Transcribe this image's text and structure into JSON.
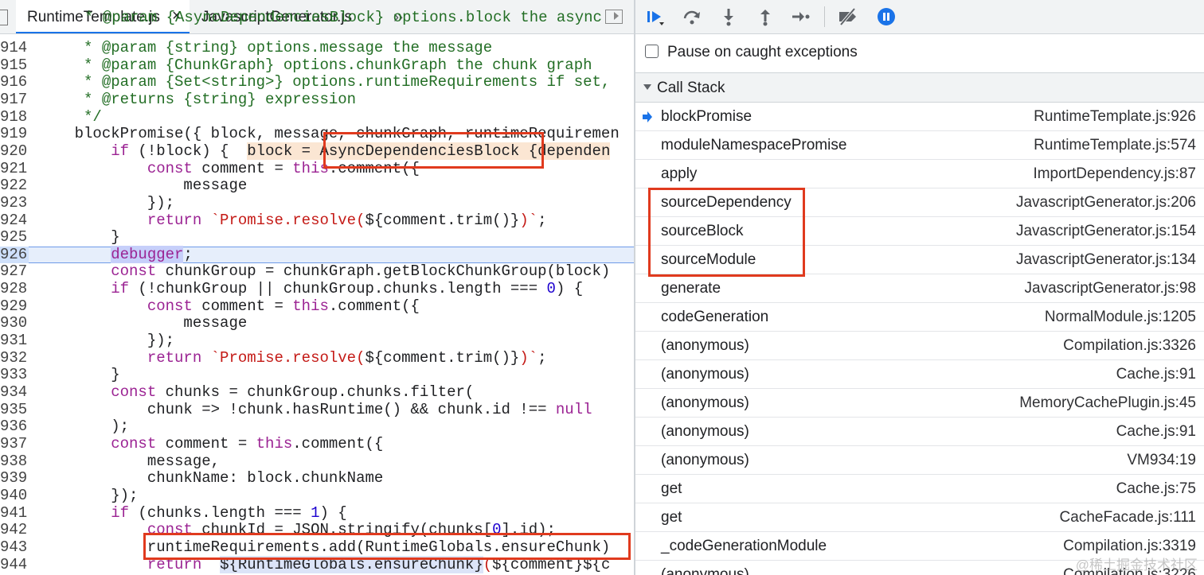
{
  "editor": {
    "tabs": [
      {
        "label": "RuntimeTemplate.js",
        "active": true,
        "close_glyph": "×"
      },
      {
        "label": "JavascriptGenerator.js",
        "active": false
      }
    ],
    "more_tabs_glyph": "»",
    "partial_top_line": "* @param {AsyncDependenciesBlock} options.block the async",
    "lines": [
      {
        "num": "914",
        "segments": [
          {
            "t": "     * @param {string} options.message the message",
            "c": "com"
          }
        ]
      },
      {
        "num": "915",
        "segments": [
          {
            "t": "     * @param {ChunkGraph} options.chunkGraph the chunk graph",
            "c": "com"
          }
        ]
      },
      {
        "num": "916",
        "segments": [
          {
            "t": "     * @param {Set<string>} options.runtimeRequirements if set, ",
            "c": "com"
          }
        ]
      },
      {
        "num": "917",
        "segments": [
          {
            "t": "     * @returns {string} expression",
            "c": "com"
          }
        ]
      },
      {
        "num": "918",
        "segments": [
          {
            "t": "     */",
            "c": "com"
          }
        ]
      },
      {
        "num": "919",
        "segments": [
          {
            "t": "    blockPromise({ block, message, chunkGraph, runtimeRequiremen",
            "c": ""
          }
        ]
      },
      {
        "num": "920",
        "segments": [
          {
            "t": "        ",
            "c": ""
          },
          {
            "t": "if",
            "c": "kw"
          },
          {
            "t": " (!block) {  ",
            "c": ""
          },
          {
            "t": "block = AsyncDependenciesBlock {dependen",
            "c": "inline"
          }
        ]
      },
      {
        "num": "921",
        "segments": [
          {
            "t": "            ",
            "c": ""
          },
          {
            "t": "const",
            "c": "kw"
          },
          {
            "t": " comment = ",
            "c": ""
          },
          {
            "t": "this",
            "c": "kw"
          },
          {
            "t": ".comment({",
            "c": ""
          }
        ]
      },
      {
        "num": "922",
        "segments": [
          {
            "t": "                message",
            "c": ""
          }
        ]
      },
      {
        "num": "923",
        "segments": [
          {
            "t": "            });",
            "c": ""
          }
        ]
      },
      {
        "num": "924",
        "segments": [
          {
            "t": "            ",
            "c": ""
          },
          {
            "t": "return",
            "c": "kw"
          },
          {
            "t": " `Promise.resolve(",
            "c": "str"
          },
          {
            "t": "${comment.trim()}",
            "c": ""
          },
          {
            "t": ")`",
            "c": "str"
          },
          {
            "t": ";",
            "c": ""
          }
        ]
      },
      {
        "num": "925",
        "segments": [
          {
            "t": "        }",
            "c": ""
          }
        ]
      },
      {
        "num": "926",
        "segments": [
          {
            "t": "        ",
            "c": ""
          },
          {
            "t": "debugger",
            "c": "debugger"
          },
          {
            "t": ";",
            "c": ""
          }
        ],
        "current": true
      },
      {
        "num": "927",
        "segments": [
          {
            "t": "        ",
            "c": ""
          },
          {
            "t": "const",
            "c": "kw"
          },
          {
            "t": " chunkGroup = chunkGraph.getBlockChunkGroup(block)",
            "c": ""
          }
        ]
      },
      {
        "num": "928",
        "segments": [
          {
            "t": "        ",
            "c": ""
          },
          {
            "t": "if",
            "c": "kw"
          },
          {
            "t": " (!chunkGroup || chunkGroup.chunks.length === ",
            "c": ""
          },
          {
            "t": "0",
            "c": "num"
          },
          {
            "t": ") {",
            "c": ""
          }
        ]
      },
      {
        "num": "929",
        "segments": [
          {
            "t": "            ",
            "c": ""
          },
          {
            "t": "const",
            "c": "kw"
          },
          {
            "t": " comment = ",
            "c": ""
          },
          {
            "t": "this",
            "c": "kw"
          },
          {
            "t": ".comment({",
            "c": ""
          }
        ]
      },
      {
        "num": "930",
        "segments": [
          {
            "t": "                message",
            "c": ""
          }
        ]
      },
      {
        "num": "931",
        "segments": [
          {
            "t": "            });",
            "c": ""
          }
        ]
      },
      {
        "num": "932",
        "segments": [
          {
            "t": "            ",
            "c": ""
          },
          {
            "t": "return",
            "c": "kw"
          },
          {
            "t": " `Promise.resolve(",
            "c": "str"
          },
          {
            "t": "${comment.trim()}",
            "c": ""
          },
          {
            "t": ")`",
            "c": "str"
          },
          {
            "t": ";",
            "c": ""
          }
        ]
      },
      {
        "num": "933",
        "segments": [
          {
            "t": "        }",
            "c": ""
          }
        ]
      },
      {
        "num": "934",
        "segments": [
          {
            "t": "        ",
            "c": ""
          },
          {
            "t": "const",
            "c": "kw"
          },
          {
            "t": " chunks = chunkGroup.chunks.filter(",
            "c": ""
          }
        ]
      },
      {
        "num": "935",
        "segments": [
          {
            "t": "            chunk => !chunk.hasRuntime() && chunk.id !== ",
            "c": ""
          },
          {
            "t": "null",
            "c": "kw"
          }
        ]
      },
      {
        "num": "936",
        "segments": [
          {
            "t": "        );",
            "c": ""
          }
        ]
      },
      {
        "num": "937",
        "segments": [
          {
            "t": "        ",
            "c": ""
          },
          {
            "t": "const",
            "c": "kw"
          },
          {
            "t": " comment = ",
            "c": ""
          },
          {
            "t": "this",
            "c": "kw"
          },
          {
            "t": ".comment({",
            "c": ""
          }
        ]
      },
      {
        "num": "938",
        "segments": [
          {
            "t": "            message,",
            "c": ""
          }
        ]
      },
      {
        "num": "939",
        "segments": [
          {
            "t": "            chunkName: block.chunkName",
            "c": ""
          }
        ]
      },
      {
        "num": "940",
        "segments": [
          {
            "t": "        });",
            "c": ""
          }
        ]
      },
      {
        "num": "941",
        "segments": [
          {
            "t": "        ",
            "c": ""
          },
          {
            "t": "if",
            "c": "kw"
          },
          {
            "t": " (chunks.length === ",
            "c": ""
          },
          {
            "t": "1",
            "c": "num"
          },
          {
            "t": ") {",
            "c": ""
          }
        ]
      },
      {
        "num": "942",
        "segments": [
          {
            "t": "            ",
            "c": ""
          },
          {
            "t": "const",
            "c": "kw"
          },
          {
            "t": " chunkId = JSON.stringify(chunks[",
            "c": ""
          },
          {
            "t": "0",
            "c": "num"
          },
          {
            "t": "].id);",
            "c": ""
          }
        ]
      },
      {
        "num": "943",
        "segments": [
          {
            "t": "            runtimeRequirements.add(RuntimeGlobals.ensureChunk)",
            "c": ""
          }
        ]
      },
      {
        "num": "944",
        "segments": [
          {
            "t": "            ",
            "c": ""
          },
          {
            "t": "return",
            "c": "kw"
          },
          {
            "t": " `",
            "c": "str"
          },
          {
            "t": "${RuntimeGlobals.ensureChunk}",
            "c": "blue"
          },
          {
            "t": "(",
            "c": "str"
          },
          {
            "t": "${comment}${c",
            "c": ""
          }
        ]
      }
    ]
  },
  "debugger": {
    "toolbar": [
      {
        "name": "resume-icon",
        "title": "Resume script execution"
      },
      {
        "name": "step-over-icon",
        "title": "Step over next function call"
      },
      {
        "name": "step-into-icon",
        "title": "Step into next function call"
      },
      {
        "name": "step-out-icon",
        "title": "Step out of current function"
      },
      {
        "name": "step-icon",
        "title": "Step"
      },
      {
        "name": "deactivate-breakpoints-icon",
        "title": "Deactivate breakpoints"
      },
      {
        "name": "pause-on-exceptions-icon",
        "title": "Pause on exceptions"
      }
    ],
    "pause_on_caught": {
      "label": "Pause on caught exceptions",
      "checked": false
    },
    "call_stack": {
      "title": "Call Stack",
      "frames": [
        {
          "fn": "blockPromise",
          "loc": "RuntimeTemplate.js:926",
          "current": true
        },
        {
          "fn": "moduleNamespacePromise",
          "loc": "RuntimeTemplate.js:574"
        },
        {
          "fn": "apply",
          "loc": "ImportDependency.js:87"
        },
        {
          "fn": "sourceDependency",
          "loc": "JavascriptGenerator.js:206"
        },
        {
          "fn": "sourceBlock",
          "loc": "JavascriptGenerator.js:154"
        },
        {
          "fn": "sourceModule",
          "loc": "JavascriptGenerator.js:134"
        },
        {
          "fn": "generate",
          "loc": "JavascriptGenerator.js:98"
        },
        {
          "fn": "codeGeneration",
          "loc": "NormalModule.js:1205"
        },
        {
          "fn": "(anonymous)",
          "loc": "Compilation.js:3326"
        },
        {
          "fn": "(anonymous)",
          "loc": "Cache.js:91"
        },
        {
          "fn": "(anonymous)",
          "loc": "MemoryCachePlugin.js:45"
        },
        {
          "fn": "(anonymous)",
          "loc": "Cache.js:91"
        },
        {
          "fn": "(anonymous)",
          "loc": "VM934:19"
        },
        {
          "fn": "get",
          "loc": "Cache.js:75"
        },
        {
          "fn": "get",
          "loc": "CacheFacade.js:111"
        },
        {
          "fn": "_codeGenerationModule",
          "loc": "Compilation.js:3319"
        },
        {
          "fn": "(anonymous)",
          "loc": "Compilation.js:3226"
        }
      ]
    },
    "watermark": "@稀土掘金技术社区"
  },
  "colors": {
    "annotation_box": "#e03a1e",
    "accent_blue": "#1a73e8",
    "comment": "#236e25",
    "keyword": "#9b2393",
    "string": "#c41a16"
  }
}
